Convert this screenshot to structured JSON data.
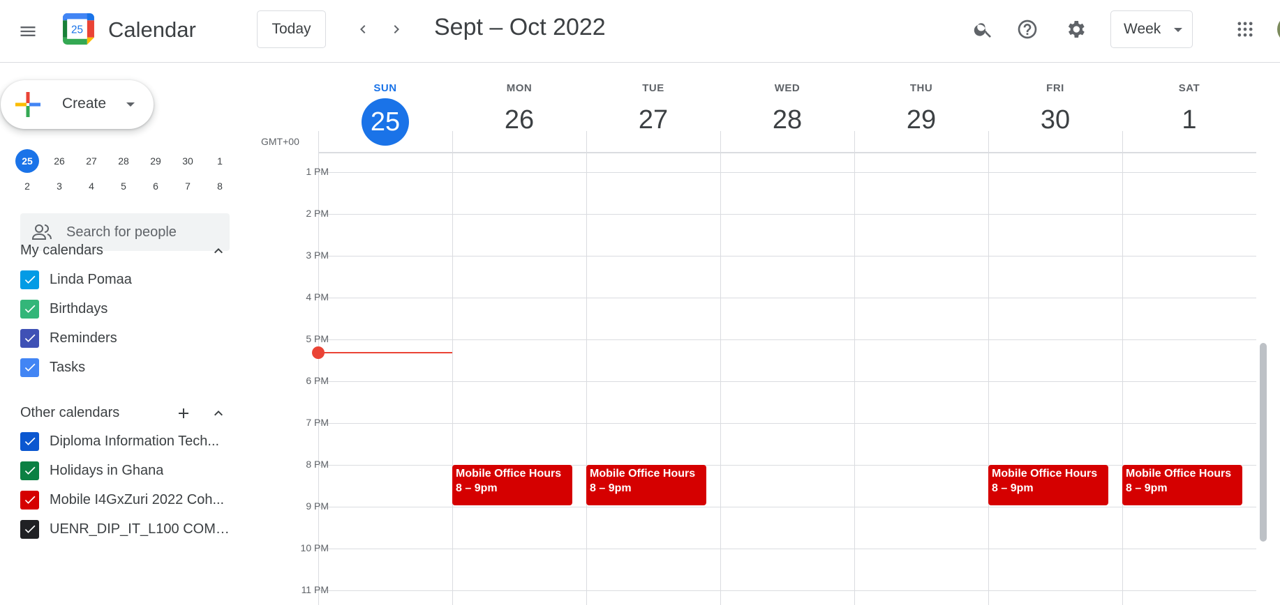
{
  "header": {
    "app_title": "Calendar",
    "logo_day": "25",
    "today_label": "Today",
    "date_range": "Sept – Oct 2022",
    "view_label": "Week"
  },
  "sidebar": {
    "create_label": "Create",
    "mini_calendar": {
      "rows": [
        [
          "25",
          "26",
          "27",
          "28",
          "29",
          "30",
          "1"
        ],
        [
          "2",
          "3",
          "4",
          "5",
          "6",
          "7",
          "8"
        ]
      ]
    },
    "people_search_placeholder": "Search for people",
    "my_calendars": {
      "title": "My calendars",
      "items": [
        {
          "label": "Linda Pomaa",
          "color": "#039be5"
        },
        {
          "label": "Birthdays",
          "color": "#33b679"
        },
        {
          "label": "Reminders",
          "color": "#3f51b5"
        },
        {
          "label": "Tasks",
          "color": "#4285f4"
        }
      ]
    },
    "other_calendars": {
      "title": "Other calendars",
      "items": [
        {
          "label": "Diploma Information Tech...",
          "color": "#0b57d0"
        },
        {
          "label": "Holidays in Ghana",
          "color": "#0b8043"
        },
        {
          "label": "Mobile I4GxZuri 2022 Coh...",
          "color": "#d50000"
        },
        {
          "label": "UENR_DIP_IT_L100 COMP...",
          "color": "#202124"
        }
      ]
    }
  },
  "grid": {
    "timezone": "GMT+00",
    "days": [
      {
        "name": "SUN",
        "num": "25",
        "today": true
      },
      {
        "name": "MON",
        "num": "26",
        "today": false
      },
      {
        "name": "TUE",
        "num": "27",
        "today": false
      },
      {
        "name": "WED",
        "num": "28",
        "today": false
      },
      {
        "name": "THU",
        "num": "29",
        "today": false
      },
      {
        "name": "FRI",
        "num": "30",
        "today": false
      },
      {
        "name": "SAT",
        "num": "1",
        "today": false
      }
    ],
    "hours": [
      "1 PM",
      "2 PM",
      "3 PM",
      "4 PM",
      "5 PM",
      "6 PM",
      "7 PM",
      "8 PM",
      "9 PM",
      "10 PM",
      "11 PM"
    ],
    "events": [
      {
        "title": "Mobile Office Hours",
        "time": "8 – 9pm",
        "day": "MON"
      },
      {
        "title": "Mobile Office Hours",
        "time": "8 – 9pm",
        "day": "TUE"
      },
      {
        "title": "Mobile Office Hours",
        "time": "8 – 9pm",
        "day": "FRI"
      },
      {
        "title": "Mobile Office Hours",
        "time": "8 – 9pm",
        "day": "SAT"
      }
    ],
    "event_color": "#d50000",
    "now_indicator_color": "#ea4335",
    "accent_color": "#1a73e8"
  }
}
